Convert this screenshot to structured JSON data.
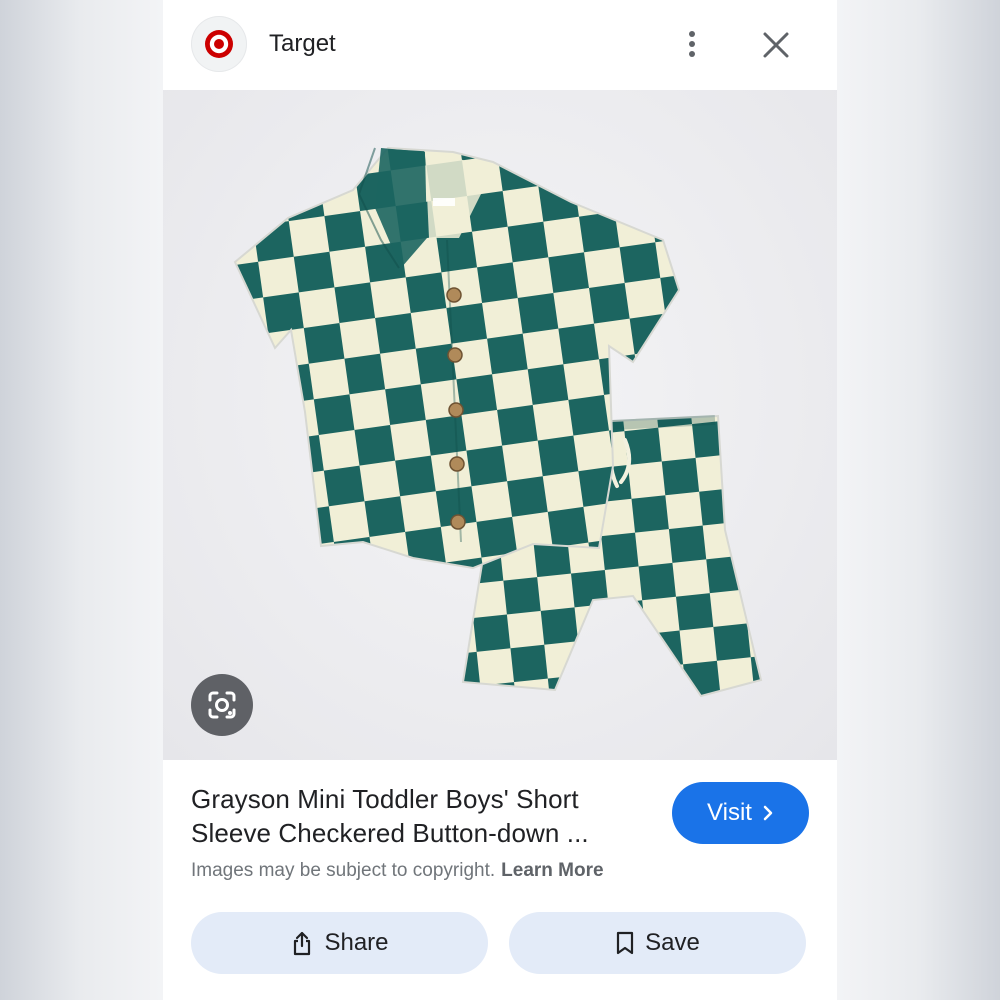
{
  "header": {
    "site_name": "Target",
    "logo_icon": "target-bullseye-icon",
    "more_icon": "more-vert-icon",
    "close_icon": "close-icon",
    "brand_color": "#cc0000"
  },
  "image": {
    "alt": "Grayson Mini Toddler Boys' Short Sleeve Checkered Button-down ...",
    "pattern_colors": {
      "dark": "#1c6560",
      "light": "#f1efd7"
    },
    "lens_icon": "google-lens-icon"
  },
  "result": {
    "title_line1": "Grayson Mini Toddler Boys' Short",
    "title_line2": "Sleeve Checkered Button-down ...",
    "visit_label": "Visit",
    "visit_icon": "chevron-right-icon",
    "visit_color": "#1a73e8",
    "copyright_text": "Images may be subject to copyright.",
    "learn_more": "Learn More"
  },
  "actions": {
    "share_label": "Share",
    "share_icon": "share-icon",
    "save_label": "Save",
    "save_icon": "bookmark-icon",
    "button_bg": "#e3ebf8"
  }
}
